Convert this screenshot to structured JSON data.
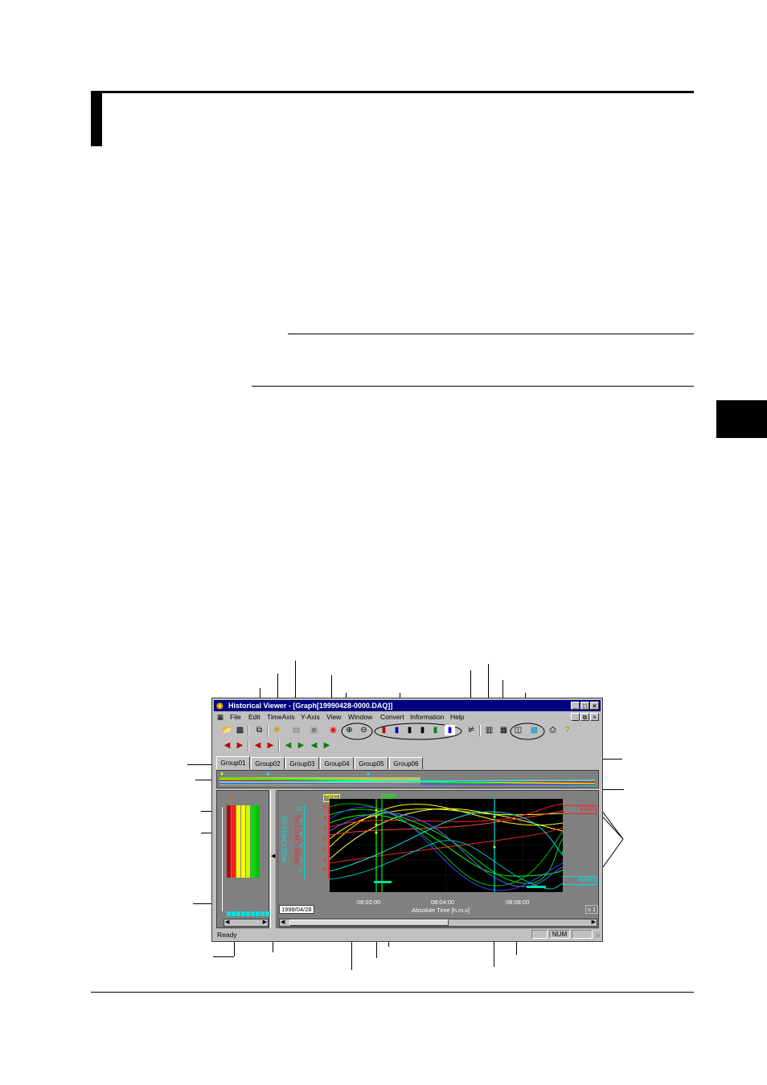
{
  "window": {
    "title": "Historical Viewer - [Graph[19990428-0000.DAQ]]",
    "menu": [
      "File",
      "Edit",
      "TimeAxis",
      "Y-Axis",
      "View",
      "Window",
      "Convert",
      "Information",
      "Help"
    ],
    "tabs": [
      "Group01",
      "Group02",
      "Group03",
      "Group04",
      "Group05",
      "Group06"
    ],
    "status_text": "Ready",
    "status_num": "NUM"
  },
  "graph": {
    "trig_label": "TRIG",
    "cursor_label": "Max",
    "date_label": "1999/04/28",
    "axis_title": "Absolute Time [h.m.s]",
    "zoom_label": "x 1",
    "time_ticks": [
      "08:02:00",
      "08:04:00",
      "08:08:00"
    ],
    "left_axis_title": "W1D:CH010 [V]",
    "left_ticks": [
      "10",
      "8",
      "6",
      "4",
      "2",
      "0"
    ],
    "right_axis_title": "W001:CH021 [V]",
    "right_ticks": [
      "6",
      "4",
      "2",
      "0",
      "-2",
      "-4",
      "-6"
    ],
    "value_box_top": "6.000",
    "value_box_bottom": "-6.000",
    "colors": {
      "titlebar": "#000080",
      "plot_bg": "#000000",
      "trace_yellow": "#ffff00",
      "trace_red": "#ff2020",
      "trace_green": "#00ff00",
      "trace_cyan": "#00e0e0",
      "trace_blue": "#4040ff"
    }
  }
}
